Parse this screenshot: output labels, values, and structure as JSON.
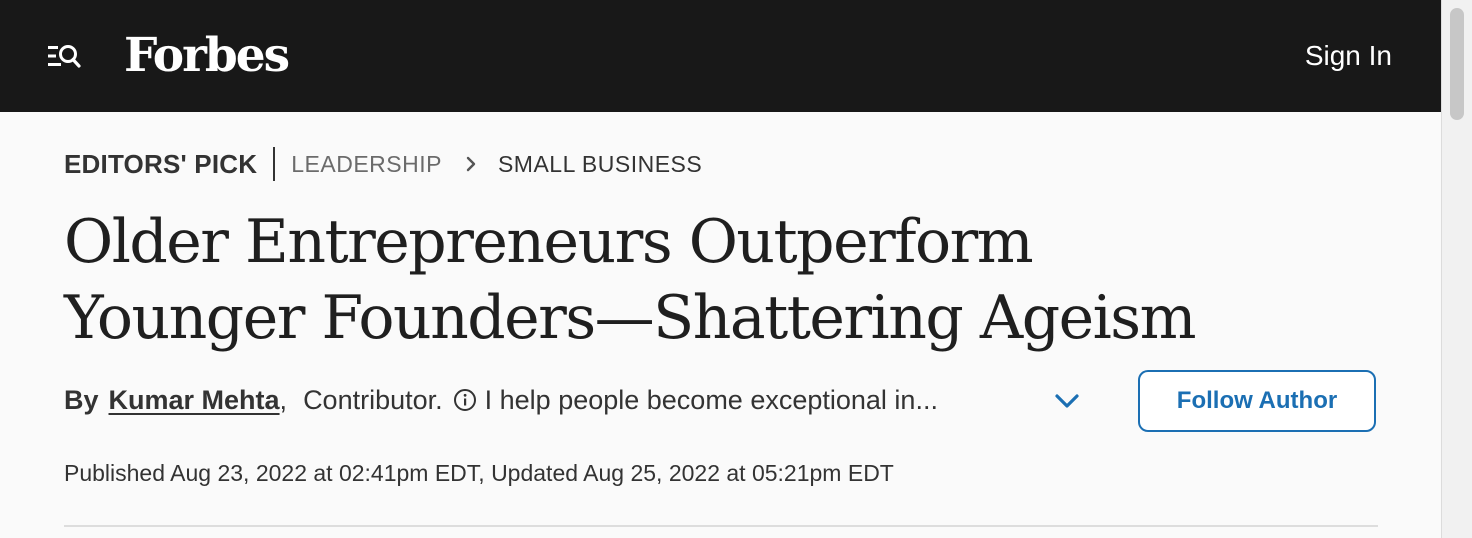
{
  "header": {
    "logo": "Forbes",
    "sign_in_label": "Sign In",
    "menu_icon": "menu-search-icon"
  },
  "breadcrumb": {
    "badge": "EDITORS' PICK",
    "section": "LEADERSHIP",
    "subsection": "SMALL BUSINESS"
  },
  "article": {
    "title": "Older Entrepreneurs Outperform Younger Founders—Shattering Ageism",
    "byline": {
      "by_label": "By",
      "author": "Kumar Mehta",
      "comma": ",",
      "role": "Contributor.",
      "bio": "I help people become exceptional in..."
    },
    "follow_label": "Follow Author",
    "dates": "Published Aug 23, 2022 at 02:41pm EDT, Updated Aug 25, 2022 at 05:21pm EDT"
  },
  "colors": {
    "header_bg": "#181818",
    "accent_blue": "#1b6fb3",
    "page_bg": "#fafafa"
  }
}
